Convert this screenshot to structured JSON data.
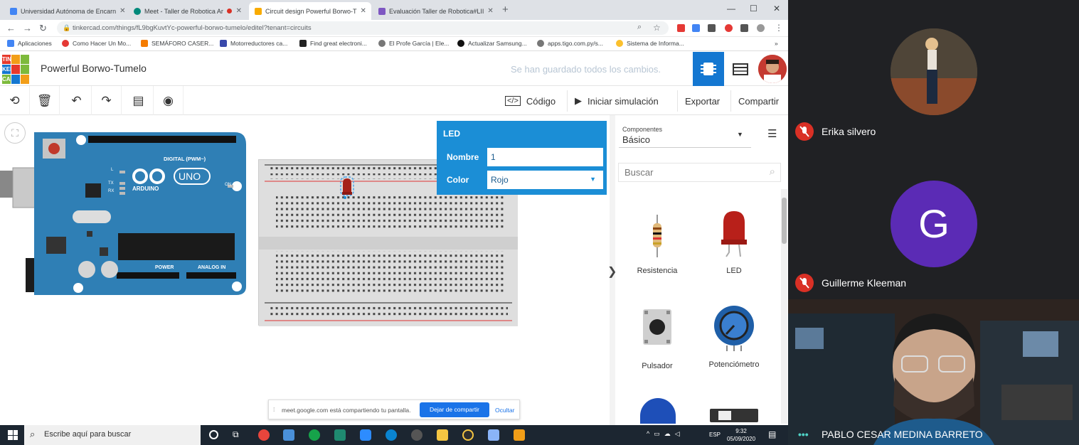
{
  "tabs": [
    {
      "label": "Universidad Autónoma de Encarn",
      "fav": "#4285f4"
    },
    {
      "label": "Meet - Taller de Robotica Ar",
      "fav": "#00897b"
    },
    {
      "label": "Circuit design Powerful Borwo-T",
      "fav": "#f9ab00"
    },
    {
      "label": "Evaluación Taller de Robotica#LII",
      "fav": "#7e57c2"
    }
  ],
  "url": "tinkercad.com/things/fL9bgKuvtYc-powerful-borwo-tumelo/editel?tenant=circuits",
  "bookmarks": [
    "Aplicaciones",
    "Como Hacer Un Mo...",
    "SEMÁFORO CASER...",
    "Motorreductores ca...",
    "Find great electroni...",
    "El Profe García | Ele...",
    "Actualizar Samsung...",
    "apps.tigo.com.py/s...",
    "Sistema de Informa..."
  ],
  "logo": [
    "TIN",
    "KER",
    "CAD"
  ],
  "project_title": "Powerful Borwo-Tumelo",
  "save_status": "Se han guardado todos los cambios.",
  "toolbar": {
    "code": "Código",
    "simulate": "Iniciar simulación",
    "export": "Exportar",
    "share": "Compartir"
  },
  "arduino": {
    "brand": "ARDUINO",
    "model": "UNO",
    "digital": "DIGITAL (PWM~)",
    "power": "POWER",
    "analog": "ANALOG IN",
    "on": "ON",
    "l": "L",
    "tx": "TX",
    "rx": "RX"
  },
  "led_panel": {
    "title": "LED",
    "name_label": "Nombre",
    "name_value": "1",
    "color_label": "Color",
    "color_value": "Rojo"
  },
  "components": {
    "label": "Componentes",
    "value": "Básico",
    "search_placeholder": "Buscar",
    "items": [
      "Resistencia",
      "LED",
      "Pulsador",
      "Potenciómetro"
    ]
  },
  "share_bar": {
    "text": "meet.google.com está compartiendo tu pantalla.",
    "stop": "Dejar de compartir",
    "hide": "Ocultar"
  },
  "taskbar": {
    "search": "Escribe aquí para buscar",
    "lang": "ESP",
    "time": "9:32",
    "date": "05/09/2020"
  },
  "meet": {
    "p1": "Erika silvero",
    "p2_initial": "G",
    "p2": "Guillerme Kleeman",
    "p3": "PABLO CESAR MEDINA BARRETO"
  },
  "colors": {
    "accent": "#1b8ed6",
    "tinkercad_blue": "#1477d1",
    "arduino": "#2f7fb5",
    "meet_avatar": "#5b2bb5",
    "mic_off": "#d93025"
  }
}
